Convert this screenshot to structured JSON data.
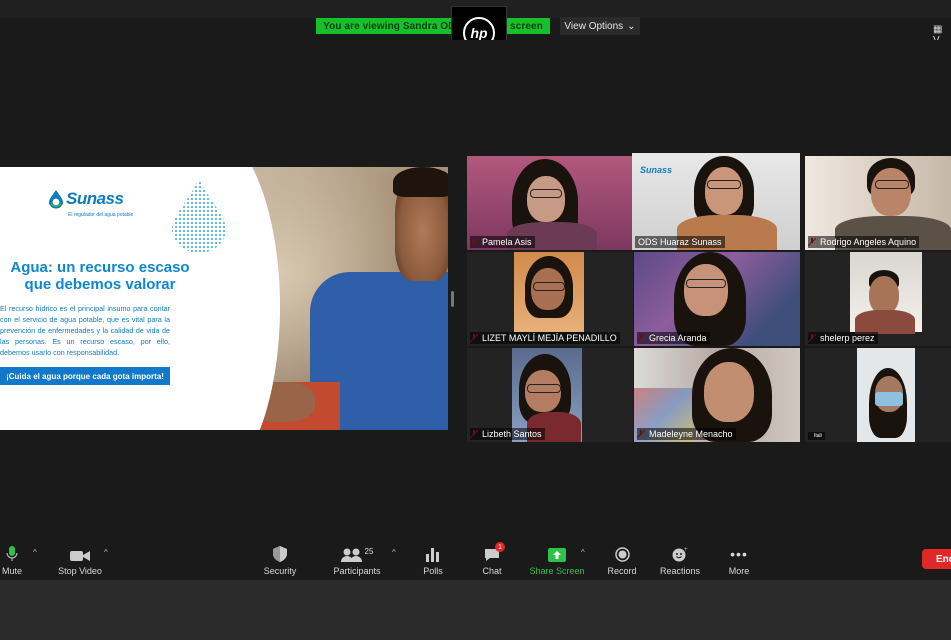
{
  "banner": {
    "text": "You are viewing Sandra ODS Huaraz's screen"
  },
  "view_options": {
    "label": "View Options"
  },
  "slide": {
    "logo": "Sunass",
    "logo_sub": "El regulador del agua potable",
    "title_line1": "Agua: un recurso escaso",
    "title_line2": "que debemos valorar",
    "body": "El recurso hídrico es el principal insumo para contar con el servicio de agua potable, que es vital para la prevención de enfermedades y la calidad de vida de las personas. Es un recurso escaso, por ello, debemos usarlo con responsabilidad.",
    "cta": "¡Cuida el agua porque cada gota importa!"
  },
  "participants": [
    {
      "name": "Pamela Asis"
    },
    {
      "name": "ODS Huaraz Sunass",
      "logo": "Sunass"
    },
    {
      "name": "Rodrigo Angeles Aquino"
    },
    {
      "name": "LIZET MAYLÍ MEJÍA PENADILLO"
    },
    {
      "name": "Grecia Aranda"
    },
    {
      "name": "shelerp perez"
    },
    {
      "name": "Lizbeth Santos"
    },
    {
      "name": "Madeleyne Menacho"
    },
    {
      "name": "Itali"
    }
  ],
  "toolbar": {
    "mute": "Mute",
    "stop_video": "Stop Video",
    "security": "Security",
    "participants": "Participants",
    "participants_count": "25",
    "polls": "Polls",
    "chat": "Chat",
    "chat_badge": "1",
    "share_screen": "Share Screen",
    "record": "Record",
    "reactions": "Reactions",
    "more": "More",
    "end": "End"
  },
  "colors": {
    "share_green": "#16c02a",
    "end_red": "#e02828",
    "active_speaker": "#b6e07e",
    "brand_blue": "#0f86d0"
  }
}
